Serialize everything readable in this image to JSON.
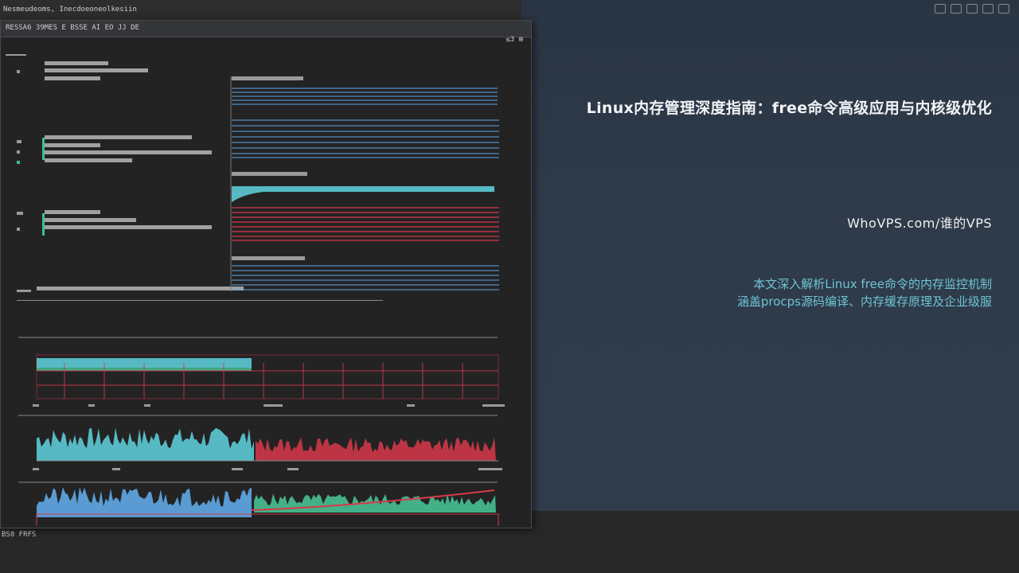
{
  "right_panel": {
    "title": "Linux内存管理深度指南：free命令高级应用与内核级优化",
    "site": "WhoVPS.com/谁的VPS",
    "description_lines": [
      "本文深入解析Linux free命令的内存监控机制",
      "涵盖procps源码编译、内存缓存原理及企业级服"
    ]
  },
  "tray_icons": [
    "window-icon",
    "window-icon",
    "window-icon",
    "window-icon",
    "window-icon"
  ],
  "window": {
    "topbar_text": "Nesmeudeoms, Inecdoeoneolkesiin",
    "header_left": "RESSA6 39MES E  BSSE AI  EO  JJ DE",
    "header_right": "≤3 ⊞"
  },
  "colors": {
    "cyan": "#5fd3e0",
    "blue": "#5fa9e6",
    "red": "#d8384a",
    "green": "#4fe0a8"
  }
}
